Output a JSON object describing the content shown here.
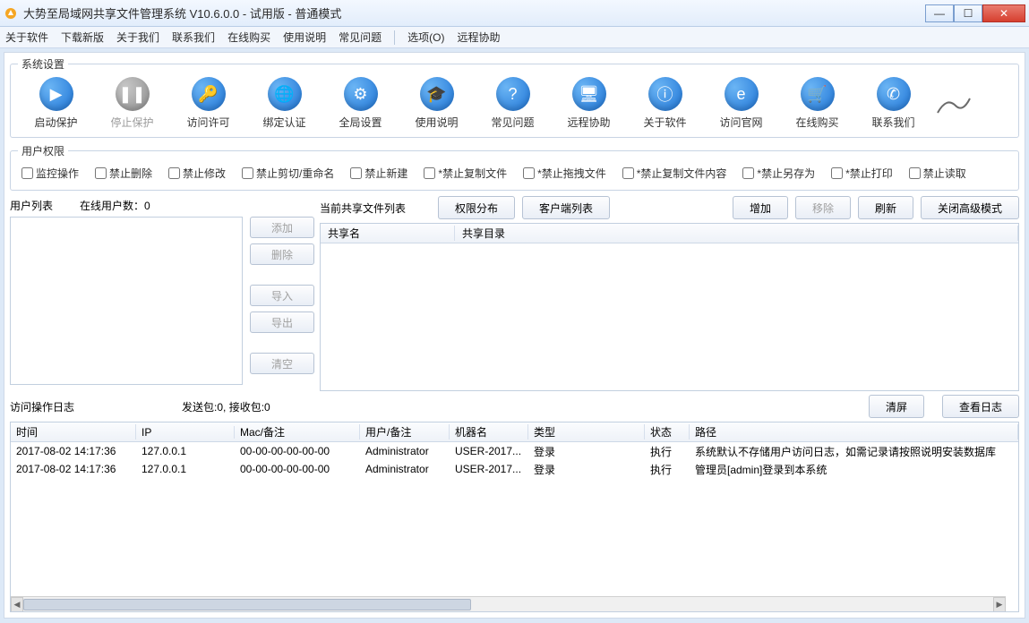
{
  "window": {
    "title": "大势至局域网共享文件管理系统 V10.6.0.0 - 试用版 - 普通模式"
  },
  "menu": {
    "about_software": "关于软件",
    "download_new": "下载新版",
    "about_us": "关于我们",
    "contact_us": "联系我们",
    "buy_online": "在线购买",
    "usage": "使用说明",
    "faq": "常见问题",
    "options": "选项(O)",
    "remote_assist": "远程协助"
  },
  "toolbar_label": "系统设置",
  "toolbar": {
    "start": "启动保护",
    "stop": "停止保护",
    "access": "访问许可",
    "bind": "绑定认证",
    "global": "全局设置",
    "usage": "使用说明",
    "faq": "常见问题",
    "remote": "远程协助",
    "about": "关于软件",
    "website": "访问官网",
    "buy": "在线购买",
    "contact": "联系我们"
  },
  "perm_label": "用户权限",
  "perm": {
    "monitor": "监控操作",
    "no_delete": "禁止删除",
    "no_modify": "禁止修改",
    "no_cut_rename": "禁止剪切/重命名",
    "no_create": "禁止新建",
    "no_copy_file": "*禁止复制文件",
    "no_drag_file": "*禁止拖拽文件",
    "no_copy_content": "*禁止复制文件内容",
    "no_save_as": "*禁止另存为",
    "no_print": "*禁止打印",
    "no_read": "禁止读取"
  },
  "userlist": {
    "title": "用户列表",
    "online": "在线用户数：0",
    "btn_add": "添加",
    "btn_del": "删除",
    "btn_import": "导入",
    "btn_export": "导出",
    "btn_clear": "清空"
  },
  "share": {
    "title": "当前共享文件列表",
    "btn_perm_dist": "权限分布",
    "btn_client_list": "客户端列表",
    "btn_add": "增加",
    "btn_remove": "移除",
    "btn_refresh": "刷新",
    "btn_close_adv": "关闭高级模式",
    "col_name": "共享名",
    "col_dir": "共享目录"
  },
  "log": {
    "title": "访问操作日志",
    "packets": "发送包:0, 接收包:0",
    "btn_clear": "清屏",
    "btn_view": "查看日志",
    "cols": {
      "time": "时间",
      "ip": "IP",
      "mac": "Mac/备注",
      "user": "用户/备注",
      "host": "机器名",
      "type": "类型",
      "status": "状态",
      "path": "路径"
    },
    "rows": [
      {
        "time": "2017-08-02 14:17:36",
        "ip": "127.0.0.1",
        "mac": "00-00-00-00-00-00",
        "user": "Administrator",
        "host": "USER-2017...",
        "type": "登录",
        "status": "执行",
        "path": "系统默认不存储用户访问日志，如需记录请按照说明安装数据库"
      },
      {
        "time": "2017-08-02 14:17:36",
        "ip": "127.0.0.1",
        "mac": "00-00-00-00-00-00",
        "user": "Administrator",
        "host": "USER-2017...",
        "type": "登录",
        "status": "执行",
        "path": "管理员[admin]登录到本系统"
      }
    ]
  }
}
